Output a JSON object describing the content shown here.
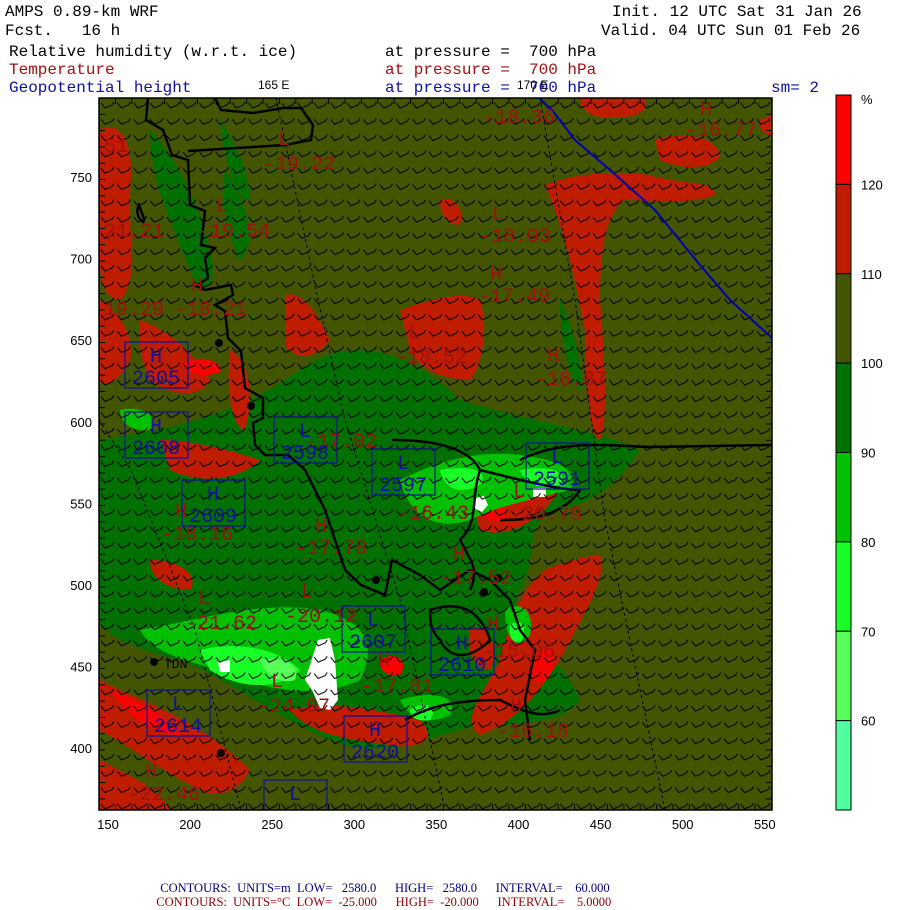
{
  "header": {
    "model": "AMPS 0.89-km WRF",
    "forecast": "Fcst.   16 h",
    "init": "Init. 12 UTC Sat 31 Jan 26",
    "valid": "Valid. 04 UTC Sun 01 Feb 26",
    "fields": [
      {
        "name": "Relative humidity (w.r.t. ice)",
        "level": "at pressure =  700 hPa",
        "color": "#000000"
      },
      {
        "name": "Temperature",
        "level": "at pressure =  700 hPa",
        "color": "#a01010"
      },
      {
        "name": "Geopotential height",
        "level": "at pressure =  700 hPa",
        "color": "#1010a0"
      }
    ],
    "smoothing": "sm= 2",
    "lon_labels": [
      "165 E",
      "170 E"
    ]
  },
  "axes": {
    "x_ticks": [
      "150",
      "200",
      "250",
      "300",
      "350",
      "400",
      "450",
      "500",
      "550"
    ],
    "y_ticks": [
      "750",
      "700",
      "650",
      "600",
      "550",
      "500",
      "450",
      "400"
    ]
  },
  "colorbar": {
    "unit": "%",
    "labels": [
      "120",
      "110",
      "100",
      "90",
      "80",
      "70",
      "60"
    ],
    "colors": [
      "#ff0000",
      "#c01c00",
      "#445500",
      "#007000",
      "#00c000",
      "#18ff28",
      "#58ff58",
      "#50ffa0"
    ]
  },
  "map": {
    "station_label": "TDN",
    "temperature_labels": [
      {
        "type": "L",
        "value": "-19.22"
      },
      {
        "type": "L",
        "value": "-19.54"
      },
      {
        "type": "H",
        "value": "-18.21"
      },
      {
        "type": "",
        "value": "-18.36"
      },
      {
        "type": "H",
        "value": "-16.77"
      },
      {
        "type": "L",
        "value": "-18.03"
      },
      {
        "type": "H",
        "value": "-17.49"
      },
      {
        "type": "L",
        "value": "-18.52"
      },
      {
        "type": "H",
        "value": "-16.87"
      },
      {
        "type": "",
        "value": "-17.02"
      },
      {
        "type": "H",
        "value": "-18.16"
      },
      {
        "type": "H",
        "value": "-17.78"
      },
      {
        "type": "L",
        "value": "-20.12"
      },
      {
        "type": "L",
        "value": "-21.62"
      },
      {
        "type": "L",
        "value": "-24.07"
      },
      {
        "type": "H",
        "value": "-17.81"
      },
      {
        "type": "H",
        "value": "-22.46"
      },
      {
        "type": "L",
        "value": "-20.79"
      },
      {
        "type": "",
        "value": "-16.43"
      },
      {
        "type": "H",
        "value": "-17.52"
      },
      {
        "type": "H",
        "value": "-15.06"
      },
      {
        "type": "H",
        "value": "-16.18"
      },
      {
        "type": "",
        "value": "-21.21"
      },
      {
        "type": "",
        "value": "-19.29"
      },
      {
        "type": "",
        "value": "51"
      }
    ],
    "height_labels": [
      {
        "type": "H",
        "value": "2605"
      },
      {
        "type": "H",
        "value": "2608"
      },
      {
        "type": "L",
        "value": "2598"
      },
      {
        "type": "L",
        "value": "2597"
      },
      {
        "type": "L",
        "value": "2591"
      },
      {
        "type": "H",
        "value": "2609"
      },
      {
        "type": "L",
        "value": "2607"
      },
      {
        "type": "H",
        "value": "2610"
      },
      {
        "type": "L",
        "value": "2614"
      },
      {
        "type": "H",
        "value": "2620"
      },
      {
        "type": "L",
        "value": ""
      }
    ]
  },
  "footer": {
    "height_contours": {
      "label": "CONTOURS:",
      "units": "UNITS=m",
      "low": "LOW=   2580.0",
      "high": "HIGH=   2580.0",
      "interval": "INTERVAL=    60.000",
      "color": "#000080"
    },
    "temp_contours": {
      "label": "CONTOURS:",
      "units": "UNITS=°C",
      "low": "LOW=  -25.000",
      "high": "HIGH=  -20.000",
      "interval": "INTERVAL=    5.0000",
      "color": "#900000"
    }
  }
}
